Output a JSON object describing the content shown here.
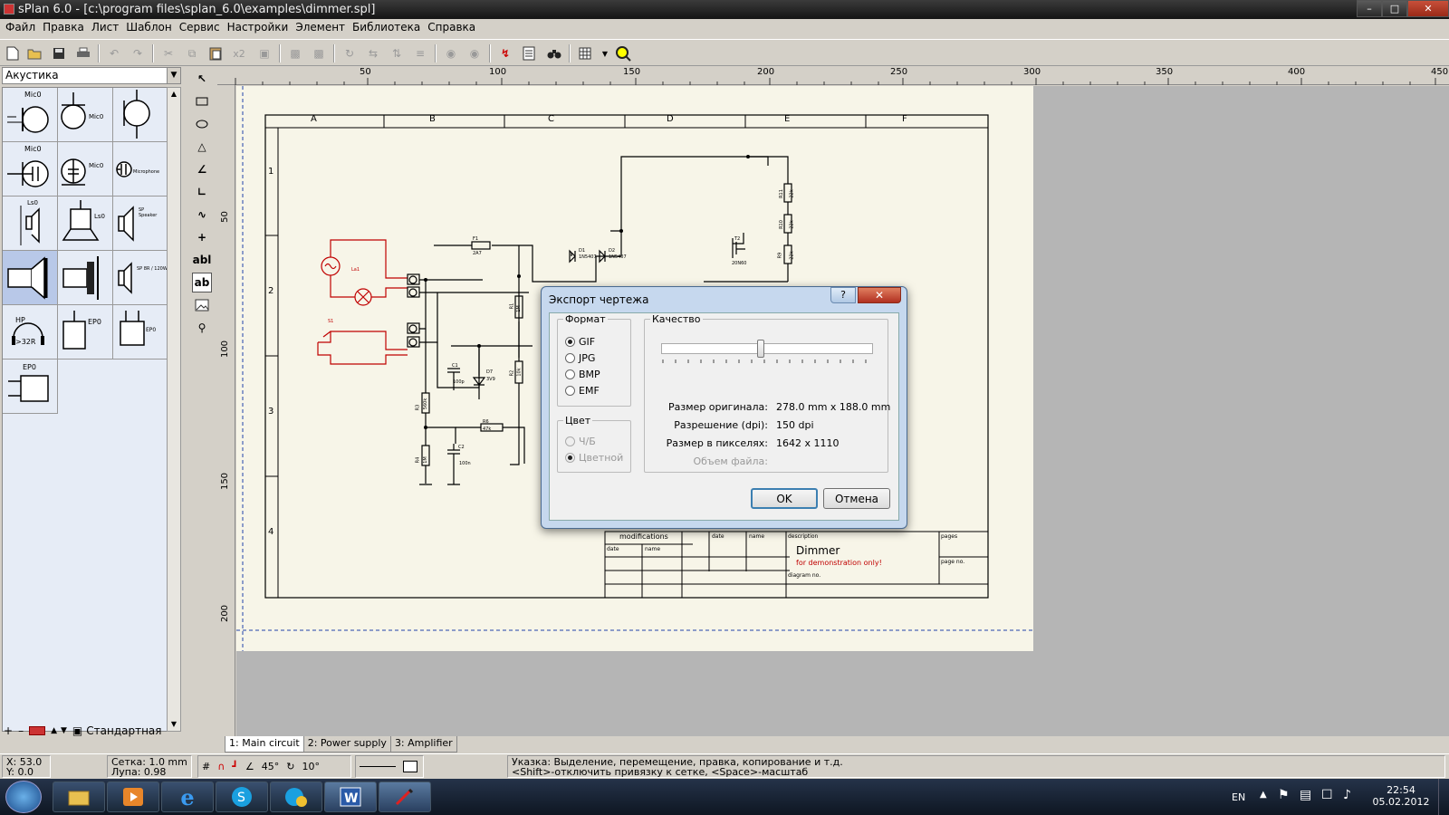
{
  "window": {
    "title": "sPlan 6.0 - [c:\\program files\\splan_6.0\\examples\\dimmer.spl]"
  },
  "menu": [
    "Файл",
    "Правка",
    "Лист",
    "Шаблон",
    "Сервис",
    "Настройки",
    "Элемент",
    "Библиотека",
    "Справка"
  ],
  "toolbar": {
    "dup_label": "x2"
  },
  "library": {
    "selected": "Акустика",
    "footer_label": "Стандартная",
    "cells": [
      {
        "label": "Mic0"
      },
      {
        "label": "Mic0"
      },
      {
        "label": ""
      },
      {
        "label": "Mic0"
      },
      {
        "label": "Mic0"
      },
      {
        "label": "Microphone"
      },
      {
        "label": "Ls0"
      },
      {
        "label": "Ls0"
      },
      {
        "label": "SP Speaker"
      },
      {
        "label": ""
      },
      {
        "label": ""
      },
      {
        "label": "SP 8R / 120W"
      },
      {
        "label": "HP >32R"
      },
      {
        "label": "EP0"
      },
      {
        "label": "EP0"
      },
      {
        "label": "EP0"
      }
    ]
  },
  "drawtools": {
    "text_label": "abl",
    "text_label2": "ab"
  },
  "ruler": {
    "h_ticks": [
      "50",
      "100",
      "150",
      "200",
      "250",
      "300",
      "350",
      "400",
      "450"
    ],
    "v_ticks": [
      "50",
      "100",
      "150",
      "200"
    ]
  },
  "drawing": {
    "columns": [
      "A",
      "B",
      "C",
      "D",
      "E",
      "F"
    ],
    "rows": [
      "1",
      "2",
      "3",
      "4"
    ],
    "title_block": {
      "modifications": "modifications",
      "date": "date",
      "name": "name",
      "description": "description",
      "pages": "pages",
      "page_no": "page no.",
      "diagram_no": "diagram no.",
      "title": "Dimmer",
      "subtitle": "for demonstration only!"
    },
    "labels": {
      "F1": "F1",
      "F1v": "2A7",
      "D1": "D1",
      "D1v": "1N5407",
      "D2": "D2",
      "D2v": "1N5407",
      "T2": "T2",
      "T2v": "20N60",
      "R11": "R11",
      "R11v": "22k",
      "R10": "R10",
      "R10v": "22k",
      "R9": "R9",
      "R9v": "22k",
      "La1": "La1",
      "S1": "S1",
      "R1": "R1",
      "R1v": "1M",
      "C1": "C1",
      "C1v": "100p",
      "D7": "D7",
      "D7v": "3V9",
      "R2": "R2",
      "R2v": "10k",
      "R3": "R3",
      "R3v": "560k",
      "R6": "R6",
      "R6v": "47k",
      "R4": "R4",
      "R4v": "1M",
      "C2": "C2",
      "C2v": "100n"
    }
  },
  "tabs": [
    "1: Main circuit",
    "2: Power supply",
    "3: Amplifier"
  ],
  "status": {
    "x": "X: 53.0",
    "y": "Y: 0.0",
    "grid": "Сетка:  1.0 mm",
    "zoom": "Лупа:   0.98",
    "angle1": "45°",
    "angle2": "10°",
    "hint1": "Указка: Выделение, перемещение, правка, копирование и т.д.",
    "hint2": "<Shift>-отключить привязку к сетке, <Space>-масштаб"
  },
  "dialog": {
    "title": "Экспорт чертежа",
    "help": "?",
    "format_label": "Формат",
    "formats": [
      "GIF",
      "JPG",
      "BMP",
      "EMF"
    ],
    "format_selected": "GIF",
    "color_label": "Цвет",
    "colors": [
      "Ч/Б",
      "Цветной"
    ],
    "color_selected": "Цветной",
    "quality_label": "Качество",
    "info": [
      {
        "k": "Размер оригинала:",
        "v": "278.0 mm x 188.0 mm"
      },
      {
        "k": "Разрешение (dpi):",
        "v": "150 dpi"
      },
      {
        "k": "Размер в пикселях:",
        "v": "1642 x 1110"
      },
      {
        "k": "Объем файла:",
        "v": ""
      }
    ],
    "ok": "OK",
    "cancel": "Отмена"
  },
  "taskbar": {
    "lang": "EN",
    "time": "22:54",
    "date": "05.02.2012"
  },
  "colors": {
    "schematic": "#000000",
    "red_circuit": "#c00000",
    "paper": "#f7f5e8",
    "canvas_bg": "#b5b5b5"
  }
}
